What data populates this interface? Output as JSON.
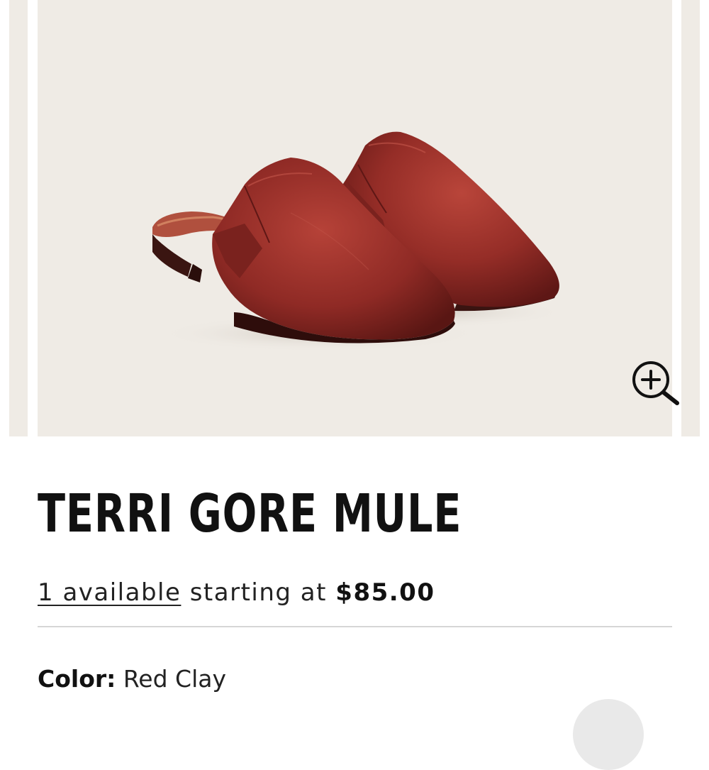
{
  "gallery": {
    "background_color": "#efebe5",
    "product_color": "#8e2a24",
    "zoom_icon": "zoom-in-icon"
  },
  "product": {
    "title": "TERRI GORE MULE",
    "availability_link": "1 available",
    "starting_at_text": "starting at",
    "price": "$85.00",
    "color_label": "Color:",
    "color_value": "Red Clay"
  },
  "colors": {
    "text": "#111111",
    "divider": "#d6d6d6"
  }
}
